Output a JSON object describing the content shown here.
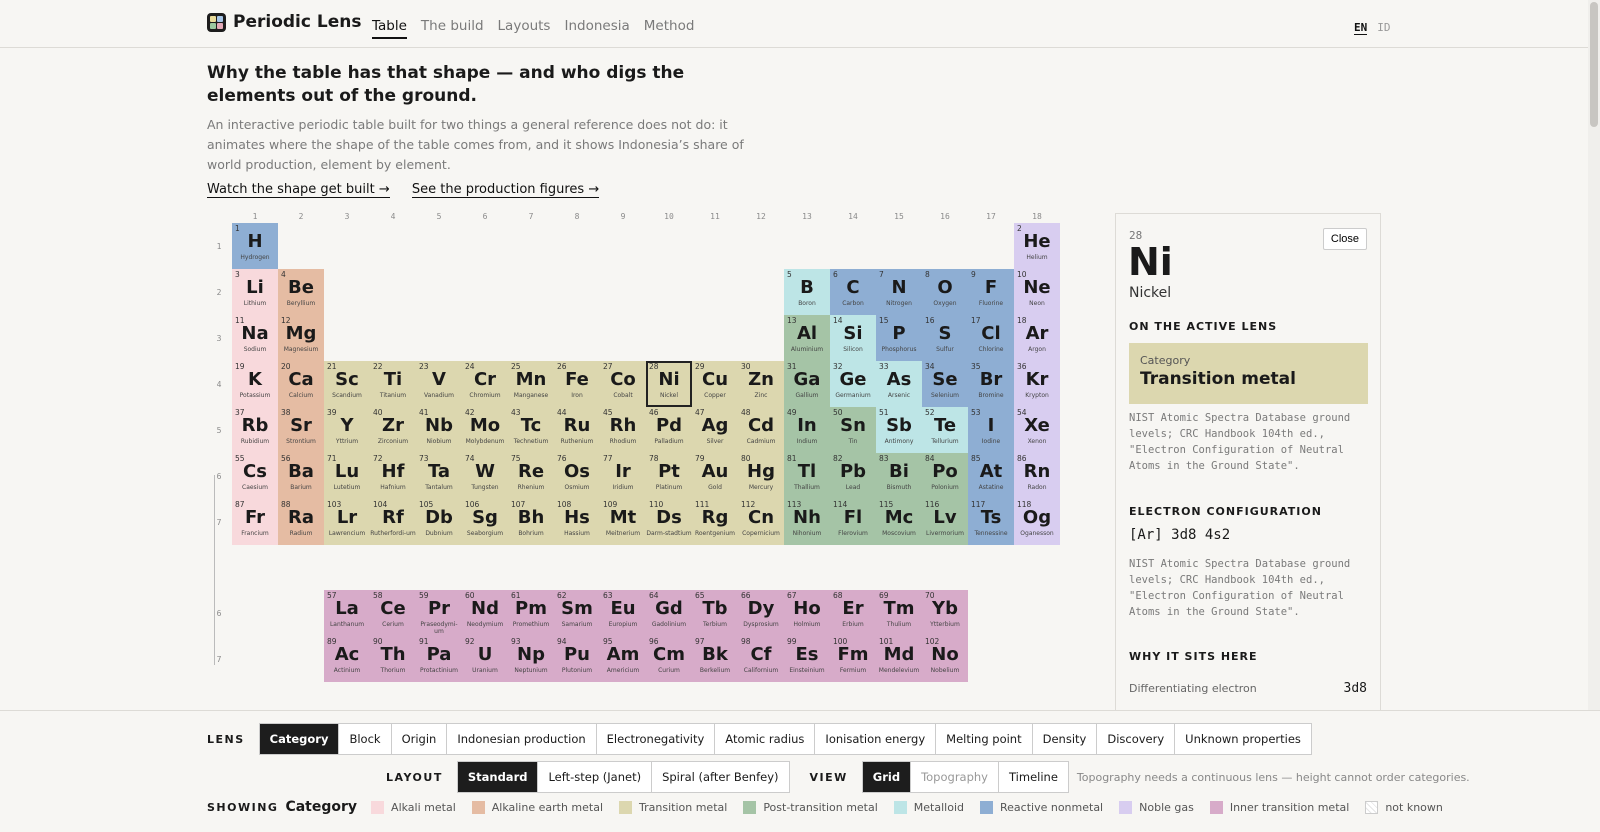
{
  "app": {
    "title": "Periodic Lens"
  },
  "nav": {
    "tabs": [
      "Table",
      "The build",
      "Layouts",
      "Indonesia",
      "Method"
    ],
    "active": "Table"
  },
  "lang": {
    "en": "EN",
    "id": "ID"
  },
  "intro": {
    "title": "Why the table has that shape — and who digs the elements out of the ground.",
    "text": "An interactive periodic table built for two things a general reference does not do: it animates where the shape of the table comes from, and it shows Indonesia’s share of world production, element by element.",
    "link1": "Watch the shape get built →",
    "link2": "See the production figures →"
  },
  "colors": {
    "alkali": "#f8d9dc",
    "alkaline": "#e5bca3",
    "transition": "#dcd7af",
    "post": "#a5c4a6",
    "metalloid": "#bde5e6",
    "nonmetal": "#8eaed3",
    "noble": "#d8cdf0",
    "inner": "#d7abc9",
    "unknown": "#ffffff"
  },
  "groups": [
    "1",
    "2",
    "3",
    "4",
    "5",
    "6",
    "7",
    "8",
    "9",
    "10",
    "11",
    "12",
    "13",
    "14",
    "15",
    "16",
    "17",
    "18"
  ],
  "periods": [
    "1",
    "2",
    "3",
    "4",
    "5",
    "6",
    "7"
  ],
  "fblock_periods": [
    "6",
    "7"
  ],
  "elements": [
    {
      "n": "1",
      "s": "H",
      "name": "Hydrogen",
      "c": "nonmetal"
    },
    {
      "n": "2",
      "s": "He",
      "name": "Helium",
      "c": "noble"
    },
    {
      "n": "3",
      "s": "Li",
      "name": "Lithium",
      "c": "alkali"
    },
    {
      "n": "4",
      "s": "Be",
      "name": "Beryllium",
      "c": "alkaline"
    },
    {
      "n": "5",
      "s": "B",
      "name": "Boron",
      "c": "metalloid"
    },
    {
      "n": "6",
      "s": "C",
      "name": "Carbon",
      "c": "nonmetal"
    },
    {
      "n": "7",
      "s": "N",
      "name": "Nitrogen",
      "c": "nonmetal"
    },
    {
      "n": "8",
      "s": "O",
      "name": "Oxygen",
      "c": "nonmetal"
    },
    {
      "n": "9",
      "s": "F",
      "name": "Fluorine",
      "c": "nonmetal"
    },
    {
      "n": "10",
      "s": "Ne",
      "name": "Neon",
      "c": "noble"
    },
    {
      "n": "11",
      "s": "Na",
      "name": "Sodium",
      "c": "alkali"
    },
    {
      "n": "12",
      "s": "Mg",
      "name": "Magnesium",
      "c": "alkaline"
    },
    {
      "n": "13",
      "s": "Al",
      "name": "Aluminium",
      "c": "post"
    },
    {
      "n": "14",
      "s": "Si",
      "name": "Silicon",
      "c": "metalloid"
    },
    {
      "n": "15",
      "s": "P",
      "name": "Phosphorus",
      "c": "nonmetal"
    },
    {
      "n": "16",
      "s": "S",
      "name": "Sulfur",
      "c": "nonmetal"
    },
    {
      "n": "17",
      "s": "Cl",
      "name": "Chlorine",
      "c": "nonmetal"
    },
    {
      "n": "18",
      "s": "Ar",
      "name": "Argon",
      "c": "noble"
    },
    {
      "n": "19",
      "s": "K",
      "name": "Potassium",
      "c": "alkali"
    },
    {
      "n": "20",
      "s": "Ca",
      "name": "Calcium",
      "c": "alkaline"
    },
    {
      "n": "21",
      "s": "Sc",
      "name": "Scandium",
      "c": "transition"
    },
    {
      "n": "22",
      "s": "Ti",
      "name": "Titanium",
      "c": "transition"
    },
    {
      "n": "23",
      "s": "V",
      "name": "Vanadium",
      "c": "transition"
    },
    {
      "n": "24",
      "s": "Cr",
      "name": "Chromium",
      "c": "transition"
    },
    {
      "n": "25",
      "s": "Mn",
      "name": "Manganese",
      "c": "transition"
    },
    {
      "n": "26",
      "s": "Fe",
      "name": "Iron",
      "c": "transition"
    },
    {
      "n": "27",
      "s": "Co",
      "name": "Cobalt",
      "c": "transition"
    },
    {
      "n": "28",
      "s": "Ni",
      "name": "Nickel",
      "c": "transition"
    },
    {
      "n": "29",
      "s": "Cu",
      "name": "Copper",
      "c": "transition"
    },
    {
      "n": "30",
      "s": "Zn",
      "name": "Zinc",
      "c": "transition"
    },
    {
      "n": "31",
      "s": "Ga",
      "name": "Gallium",
      "c": "post"
    },
    {
      "n": "32",
      "s": "Ge",
      "name": "Germanium",
      "c": "metalloid"
    },
    {
      "n": "33",
      "s": "As",
      "name": "Arsenic",
      "c": "metalloid"
    },
    {
      "n": "34",
      "s": "Se",
      "name": "Selenium",
      "c": "nonmetal"
    },
    {
      "n": "35",
      "s": "Br",
      "name": "Bromine",
      "c": "nonmetal"
    },
    {
      "n": "36",
      "s": "Kr",
      "name": "Krypton",
      "c": "noble"
    },
    {
      "n": "37",
      "s": "Rb",
      "name": "Rubidium",
      "c": "alkali"
    },
    {
      "n": "38",
      "s": "Sr",
      "name": "Strontium",
      "c": "alkaline"
    },
    {
      "n": "39",
      "s": "Y",
      "name": "Yttrium",
      "c": "transition"
    },
    {
      "n": "40",
      "s": "Zr",
      "name": "Zirconium",
      "c": "transition"
    },
    {
      "n": "41",
      "s": "Nb",
      "name": "Niobium",
      "c": "transition"
    },
    {
      "n": "42",
      "s": "Mo",
      "name": "Molybdenum",
      "c": "transition"
    },
    {
      "n": "43",
      "s": "Tc",
      "name": "Technetium",
      "c": "transition"
    },
    {
      "n": "44",
      "s": "Ru",
      "name": "Ruthenium",
      "c": "transition"
    },
    {
      "n": "45",
      "s": "Rh",
      "name": "Rhodium",
      "c": "transition"
    },
    {
      "n": "46",
      "s": "Pd",
      "name": "Palladium",
      "c": "transition"
    },
    {
      "n": "47",
      "s": "Ag",
      "name": "Silver",
      "c": "transition"
    },
    {
      "n": "48",
      "s": "Cd",
      "name": "Cadmium",
      "c": "transition"
    },
    {
      "n": "49",
      "s": "In",
      "name": "Indium",
      "c": "post"
    },
    {
      "n": "50",
      "s": "Sn",
      "name": "Tin",
      "c": "post"
    },
    {
      "n": "51",
      "s": "Sb",
      "name": "Antimony",
      "c": "metalloid"
    },
    {
      "n": "52",
      "s": "Te",
      "name": "Tellurium",
      "c": "metalloid"
    },
    {
      "n": "53",
      "s": "I",
      "name": "Iodine",
      "c": "nonmetal"
    },
    {
      "n": "54",
      "s": "Xe",
      "name": "Xenon",
      "c": "noble"
    },
    {
      "n": "55",
      "s": "Cs",
      "name": "Caesium",
      "c": "alkali"
    },
    {
      "n": "56",
      "s": "Ba",
      "name": "Barium",
      "c": "alkaline"
    },
    {
      "n": "71",
      "s": "Lu",
      "name": "Lutetium",
      "c": "transition"
    },
    {
      "n": "72",
      "s": "Hf",
      "name": "Hafnium",
      "c": "transition"
    },
    {
      "n": "73",
      "s": "Ta",
      "name": "Tantalum",
      "c": "transition"
    },
    {
      "n": "74",
      "s": "W",
      "name": "Tungsten",
      "c": "transition"
    },
    {
      "n": "75",
      "s": "Re",
      "name": "Rhenium",
      "c": "transition"
    },
    {
      "n": "76",
      "s": "Os",
      "name": "Osmium",
      "c": "transition"
    },
    {
      "n": "77",
      "s": "Ir",
      "name": "Iridium",
      "c": "transition"
    },
    {
      "n": "78",
      "s": "Pt",
      "name": "Platinum",
      "c": "transition"
    },
    {
      "n": "79",
      "s": "Au",
      "name": "Gold",
      "c": "transition"
    },
    {
      "n": "80",
      "s": "Hg",
      "name": "Mercury",
      "c": "transition"
    },
    {
      "n": "81",
      "s": "Tl",
      "name": "Thallium",
      "c": "post"
    },
    {
      "n": "82",
      "s": "Pb",
      "name": "Lead",
      "c": "post"
    },
    {
      "n": "83",
      "s": "Bi",
      "name": "Bismuth",
      "c": "post"
    },
    {
      "n": "84",
      "s": "Po",
      "name": "Polonium",
      "c": "post"
    },
    {
      "n": "85",
      "s": "At",
      "name": "Astatine",
      "c": "nonmetal"
    },
    {
      "n": "86",
      "s": "Rn",
      "name": "Radon",
      "c": "noble"
    },
    {
      "n": "87",
      "s": "Fr",
      "name": "Francium",
      "c": "alkali"
    },
    {
      "n": "88",
      "s": "Ra",
      "name": "Radium",
      "c": "alkaline"
    },
    {
      "n": "103",
      "s": "Lr",
      "name": "Lawrencium",
      "c": "transition"
    },
    {
      "n": "104",
      "s": "Rf",
      "name": "Rutherfordi-um",
      "c": "transition"
    },
    {
      "n": "105",
      "s": "Db",
      "name": "Dubnium",
      "c": "transition"
    },
    {
      "n": "106",
      "s": "Sg",
      "name": "Seaborgium",
      "c": "transition"
    },
    {
      "n": "107",
      "s": "Bh",
      "name": "Bohrium",
      "c": "transition"
    },
    {
      "n": "108",
      "s": "Hs",
      "name": "Hassium",
      "c": "transition"
    },
    {
      "n": "109",
      "s": "Mt",
      "name": "Meitnerium",
      "c": "transition"
    },
    {
      "n": "110",
      "s": "Ds",
      "name": "Darm-stadtium",
      "c": "transition"
    },
    {
      "n": "111",
      "s": "Rg",
      "name": "Roentgenium",
      "c": "transition"
    },
    {
      "n": "112",
      "s": "Cn",
      "name": "Copernicium",
      "c": "transition"
    },
    {
      "n": "113",
      "s": "Nh",
      "name": "Nihonium",
      "c": "post"
    },
    {
      "n": "114",
      "s": "Fl",
      "name": "Flerovium",
      "c": "post"
    },
    {
      "n": "115",
      "s": "Mc",
      "name": "Moscovium",
      "c": "post"
    },
    {
      "n": "116",
      "s": "Lv",
      "name": "Livermorium",
      "c": "post"
    },
    {
      "n": "117",
      "s": "Ts",
      "name": "Tennessine",
      "c": "nonmetal"
    },
    {
      "n": "118",
      "s": "Og",
      "name": "Oganesson",
      "c": "noble"
    },
    {
      "n": "57",
      "s": "La",
      "name": "Lanthanum",
      "c": "inner"
    },
    {
      "n": "58",
      "s": "Ce",
      "name": "Cerium",
      "c": "inner"
    },
    {
      "n": "59",
      "s": "Pr",
      "name": "Praseodymi-um",
      "c": "inner"
    },
    {
      "n": "60",
      "s": "Nd",
      "name": "Neodymium",
      "c": "inner"
    },
    {
      "n": "61",
      "s": "Pm",
      "name": "Promethium",
      "c": "inner"
    },
    {
      "n": "62",
      "s": "Sm",
      "name": "Samarium",
      "c": "inner"
    },
    {
      "n": "63",
      "s": "Eu",
      "name": "Europium",
      "c": "inner"
    },
    {
      "n": "64",
      "s": "Gd",
      "name": "Gadolinium",
      "c": "inner"
    },
    {
      "n": "65",
      "s": "Tb",
      "name": "Terbium",
      "c": "inner"
    },
    {
      "n": "66",
      "s": "Dy",
      "name": "Dysprosium",
      "c": "inner"
    },
    {
      "n": "67",
      "s": "Ho",
      "name": "Holmium",
      "c": "inner"
    },
    {
      "n": "68",
      "s": "Er",
      "name": "Erbium",
      "c": "inner"
    },
    {
      "n": "69",
      "s": "Tm",
      "name": "Thulium",
      "c": "inner"
    },
    {
      "n": "70",
      "s": "Yb",
      "name": "Ytterbium",
      "c": "inner"
    },
    {
      "n": "89",
      "s": "Ac",
      "name": "Actinium",
      "c": "inner"
    },
    {
      "n": "90",
      "s": "Th",
      "name": "Thorium",
      "c": "inner"
    },
    {
      "n": "91",
      "s": "Pa",
      "name": "Protactinium",
      "c": "inner"
    },
    {
      "n": "92",
      "s": "U",
      "name": "Uranium",
      "c": "inner"
    },
    {
      "n": "93",
      "s": "Np",
      "name": "Neptunium",
      "c": "inner"
    },
    {
      "n": "94",
      "s": "Pu",
      "name": "Plutonium",
      "c": "inner"
    },
    {
      "n": "95",
      "s": "Am",
      "name": "Americium",
      "c": "inner"
    },
    {
      "n": "96",
      "s": "Cm",
      "name": "Curium",
      "c": "inner"
    },
    {
      "n": "97",
      "s": "Bk",
      "name": "Berkelium",
      "c": "inner"
    },
    {
      "n": "98",
      "s": "Cf",
      "name": "Californium",
      "c": "inner"
    },
    {
      "n": "99",
      "s": "Es",
      "name": "Einsteinium",
      "c": "inner"
    },
    {
      "n": "100",
      "s": "Fm",
      "name": "Fermium",
      "c": "inner"
    },
    {
      "n": "101",
      "s": "Md",
      "name": "Mendelevium",
      "c": "inner"
    },
    {
      "n": "102",
      "s": "No",
      "name": "Nobelium",
      "c": "inner"
    }
  ],
  "selected": "28",
  "panel": {
    "number": "28",
    "symbol": "Ni",
    "name": "Nickel",
    "close": "Close",
    "lens_heading": "ON THE ACTIVE LENS",
    "cat_label": "Category",
    "cat_value": "Transition metal",
    "source": "NIST Atomic Spectra Database ground levels; CRC Handbook 104th ed., \"Electron Configuration of Neutral Atoms in the Ground State\".",
    "config_heading": "ELECTRON CONFIGURATION",
    "config": "[Ar] 3d8 4s2",
    "why_heading": "WHY IT SITS HERE",
    "diff_label": "Differentiating electron",
    "diff_value": "3d8"
  },
  "controls": {
    "lens_label": "LENS",
    "lenses": [
      "Category",
      "Block",
      "Origin",
      "Indonesian production",
      "Electronegativity",
      "Atomic radius",
      "Ionisation energy",
      "Melting point",
      "Density",
      "Discovery",
      "Unknown properties"
    ],
    "active_lens": "Category",
    "layout_label": "LAYOUT",
    "layouts": [
      "Standard",
      "Left-step (Janet)",
      "Spiral (after Benfey)"
    ],
    "active_layout": "Standard",
    "view_label": "VIEW",
    "views": [
      "Grid",
      "Topography",
      "Timeline"
    ],
    "active_view": "Grid",
    "disabled_view": "Topography",
    "note": "Topography needs a continuous lens — height cannot order categories."
  },
  "legend": {
    "showing_label": "SHOWING",
    "showing_value": "Category",
    "items": [
      {
        "label": "Alkali metal",
        "c": "alkali"
      },
      {
        "label": "Alkaline earth metal",
        "c": "alkaline"
      },
      {
        "label": "Transition metal",
        "c": "transition"
      },
      {
        "label": "Post-transition metal",
        "c": "post"
      },
      {
        "label": "Metalloid",
        "c": "metalloid"
      },
      {
        "label": "Reactive nonmetal",
        "c": "nonmetal"
      },
      {
        "label": "Noble gas",
        "c": "noble"
      },
      {
        "label": "Inner transition metal",
        "c": "inner"
      },
      {
        "label": "not known",
        "c": "unknown"
      }
    ]
  }
}
